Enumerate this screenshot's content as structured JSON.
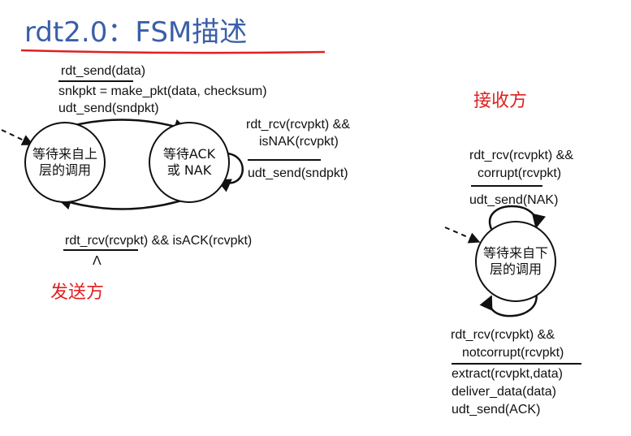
{
  "title": "rdt2.0：FSM描述",
  "sender": {
    "label": "发送方",
    "states": {
      "wait_above": "等待来自上层的调用",
      "wait_ack": "等待ACK或 NAK"
    },
    "top_transition": {
      "event": "rdt_send(data)",
      "actions": [
        "snkpkt = make_pkt(data, checksum)",
        "udt_send(sndpkt)"
      ]
    },
    "self_transition": {
      "event_lines": [
        "rdt_rcv(rcvpkt) &&",
        "isNAK(rcvpkt)"
      ],
      "action": "udt_send(sndpkt)"
    },
    "bottom_transition": {
      "event": "rdt_rcv(rcvpkt) && isACK(rcvpkt)",
      "action": "Λ"
    }
  },
  "receiver": {
    "label": "接收方",
    "state": "等待来自下层的调用",
    "top_transition": {
      "event_lines": [
        "rdt_rcv(rcvpkt) &&",
        "corrupt(rcvpkt)"
      ],
      "action": "udt_send(NAK)"
    },
    "bottom_transition": {
      "event_lines": [
        "rdt_rcv(rcvpkt) &&",
        "notcorrupt(rcvpkt)"
      ],
      "actions": [
        "extract(rcvpkt,data)",
        "deliver_data(data)",
        "udt_send(ACK)"
      ]
    }
  },
  "colors": {
    "title": "#3a5fa8",
    "accent": "#e02020",
    "line": "#111111"
  }
}
